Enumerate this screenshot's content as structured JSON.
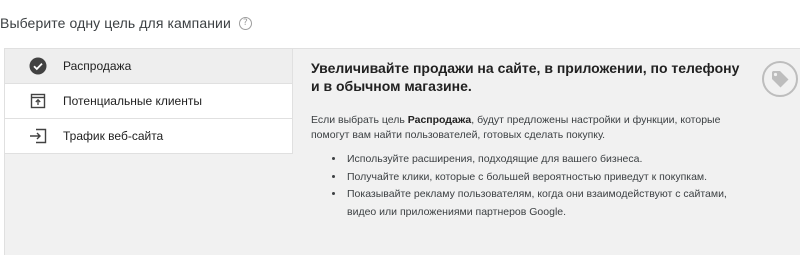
{
  "header": {
    "title": "Выберите одну цель для кампании",
    "help_icon": "help-circle-icon"
  },
  "goals": [
    {
      "label": "Распродажа",
      "icon": "check-circle-icon",
      "selected": true
    },
    {
      "label": "Потенциальные клиенты",
      "icon": "lead-form-icon",
      "selected": false
    },
    {
      "label": "Трафик веб-сайта",
      "icon": "login-arrow-icon",
      "selected": false
    }
  ],
  "detail": {
    "title": "Увеличивайте продажи на сайте, в приложении, по телефону и в обычном магазине.",
    "desc_prefix": "Если выбрать цель ",
    "desc_bold": "Распродажа",
    "desc_suffix": ", будут предложены настройки и функции, которые помогут вам найти пользователей, готовых сделать покупку.",
    "bullets": [
      "Используйте расширения, подходящие для вашего бизнеса.",
      "Получайте клики, которые с большей вероятностью приведут к покупкам.",
      "Показывайте рекламу пользователям, когда они взаимодействуют с сайтами, видео или приложениями партнеров Google."
    ],
    "decor_icon": "tag-icon"
  },
  "colors": {
    "panel_bg": "#f1f1f1",
    "selected_bg": "#eeeeee",
    "icon_dark": "#424242",
    "icon_light": "#bdbdbd"
  }
}
